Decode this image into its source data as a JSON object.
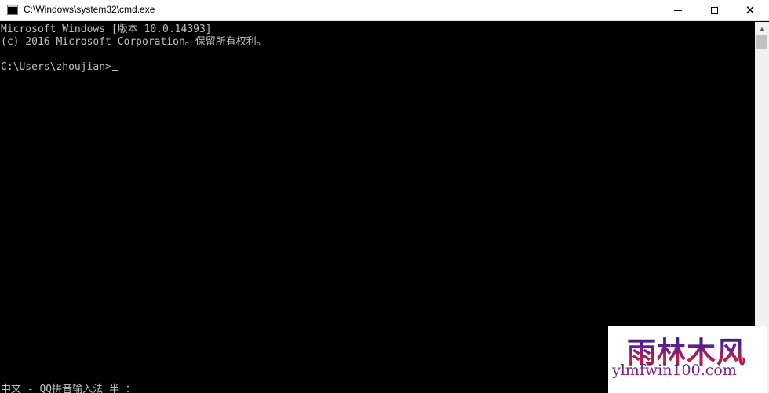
{
  "window": {
    "title": "C:\\Windows\\system32\\cmd.exe",
    "icon": "cmd-icon"
  },
  "controls": {
    "minimize": "minimize-icon",
    "maximize": "maximize-icon",
    "close": "close-icon",
    "close_glyph": "✕"
  },
  "console": {
    "lines": [
      "Microsoft Windows [版本 10.0.14393]",
      "(c) 2016 Microsoft Corporation。保留所有权利。",
      "C:\\Users\\zhoujian>"
    ],
    "ime_status": "中文 - QQ拼音输入法 半 ："
  },
  "watermark": {
    "title": "雨林木风",
    "url": "ylmfwin100.com"
  },
  "colors": {
    "console_bg": "#000000",
    "console_fg": "#c0c0c0",
    "titlebar_bg": "#ffffff"
  }
}
